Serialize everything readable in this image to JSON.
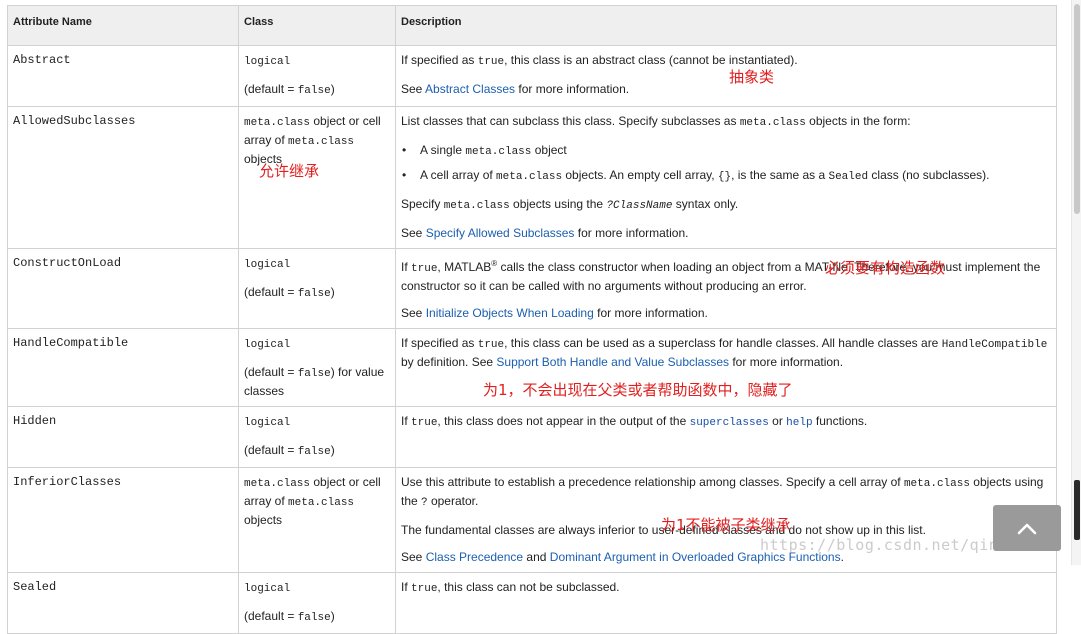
{
  "table": {
    "headers": {
      "name": "Attribute Name",
      "cls": "Class",
      "desc": "Description"
    },
    "rows": [
      {
        "name": "Abstract",
        "class_type": "logical",
        "class_default_prefix": "(default = ",
        "class_default_value": "false",
        "class_default_suffix": ")",
        "d1_a": "If specified as ",
        "d1_code": "true",
        "d1_b": ", this class is an abstract class (cannot be instantiated).",
        "d2_a": "See ",
        "d2_link": "Abstract Classes",
        "d2_b": " for more information."
      },
      {
        "name": "AllowedSubclasses",
        "class_code1": "meta.class",
        "class_t1": " object or cell array of ",
        "class_code2": "meta.class",
        "class_t2": " objects",
        "d1_a": "List classes that can subclass this class. Specify subclasses as ",
        "d1_code": "meta.class",
        "d1_b": " objects in the form:",
        "li1_a": "A single ",
        "li1_code": "meta.class",
        "li1_b": " object",
        "li2_a": "A cell array of ",
        "li2_code1": "meta.class",
        "li2_b": " objects. An empty cell array, ",
        "li2_code2": "{}",
        "li2_c": ", is the same as a ",
        "li2_code3": "Sealed",
        "li2_d": " class (no subclasses).",
        "d2_a": "Specify ",
        "d2_code1": "meta.class",
        "d2_b": " objects using the ",
        "d2_code2": "?ClassName",
        "d2_c": " syntax only.",
        "d3_a": "See ",
        "d3_link": "Specify Allowed Subclasses",
        "d3_b": " for more information."
      },
      {
        "name": "ConstructOnLoad",
        "class_type": "logical",
        "class_default_prefix": "(default = ",
        "class_default_value": "false",
        "class_default_suffix": ")",
        "d1_a": "If ",
        "d1_code": "true",
        "d1_b": ", MATLAB",
        "d1_reg": "®",
        "d1_c": " calls the class constructor when loading an object from a MAT-file. Therefore, you must implement the constructor so it can be called with no arguments without producing an error.",
        "d2_a": "See ",
        "d2_link": "Initialize Objects When Loading",
        "d2_b": " for more information."
      },
      {
        "name": "HandleCompatible",
        "class_type": "logical",
        "class_default_prefix": "(default = ",
        "class_default_value": "false",
        "class_default_suffix": ") for value classes",
        "d1_a": "If specified as ",
        "d1_code": "true",
        "d1_b": ", this class can be used as a superclass for handle classes. All handle classes are ",
        "d1_code2": "HandleCompatible",
        "d1_c": " by definition. See ",
        "d1_link": "Support Both Handle and Value Subclasses",
        "d1_d": " for more information."
      },
      {
        "name": "Hidden",
        "class_type": "logical",
        "class_default_prefix": "(default = ",
        "class_default_value": "false",
        "class_default_suffix": ")",
        "d1_a": "If ",
        "d1_code": "true",
        "d1_b": ", this class does not appear in the output of the ",
        "d1_code2": "superclasses",
        "d1_c": " or ",
        "d1_code3": "help",
        "d1_d": " functions."
      },
      {
        "name": "InferiorClasses",
        "class_code1": "meta.class",
        "class_t1": " object or cell array of ",
        "class_code2": "meta.class",
        "class_t2": " objects",
        "d1_a": "Use this attribute to establish a precedence relationship among classes. Specify a cell array of ",
        "d1_code": "meta.class",
        "d1_b": " objects using the ",
        "d1_code2": "?",
        "d1_c": " operator.",
        "d2": "The fundamental classes are always inferior to user-defined classes and do not show up in this list.",
        "d3_a": "See ",
        "d3_link1": "Class Precedence",
        "d3_b": " and ",
        "d3_link2": "Dominant Argument in Overloaded Graphics Functions",
        "d3_c": "."
      },
      {
        "name": "Sealed",
        "class_type": "logical",
        "class_default_prefix": "(default = ",
        "class_default_value": "false",
        "class_default_suffix": ")",
        "d1_a": "If ",
        "d1_code": "true",
        "d1_b": ", this class can not be subclassed."
      }
    ]
  },
  "annotations": {
    "abstract": "抽象类",
    "allowed": "允许继承",
    "construct": "必须要有构造函数",
    "hidden": "为1，不会出现在父类或者帮助函数中，隐藏了",
    "sealed": "为1不能被子类继承"
  },
  "watermark": "https://blog.csdn.net/qinze5857",
  "colors": {
    "annotation": "#e02020",
    "link": "#1b5fb0",
    "header_bg": "#efefef"
  },
  "icons": {
    "back_to_top": "chevron-up-icon"
  }
}
